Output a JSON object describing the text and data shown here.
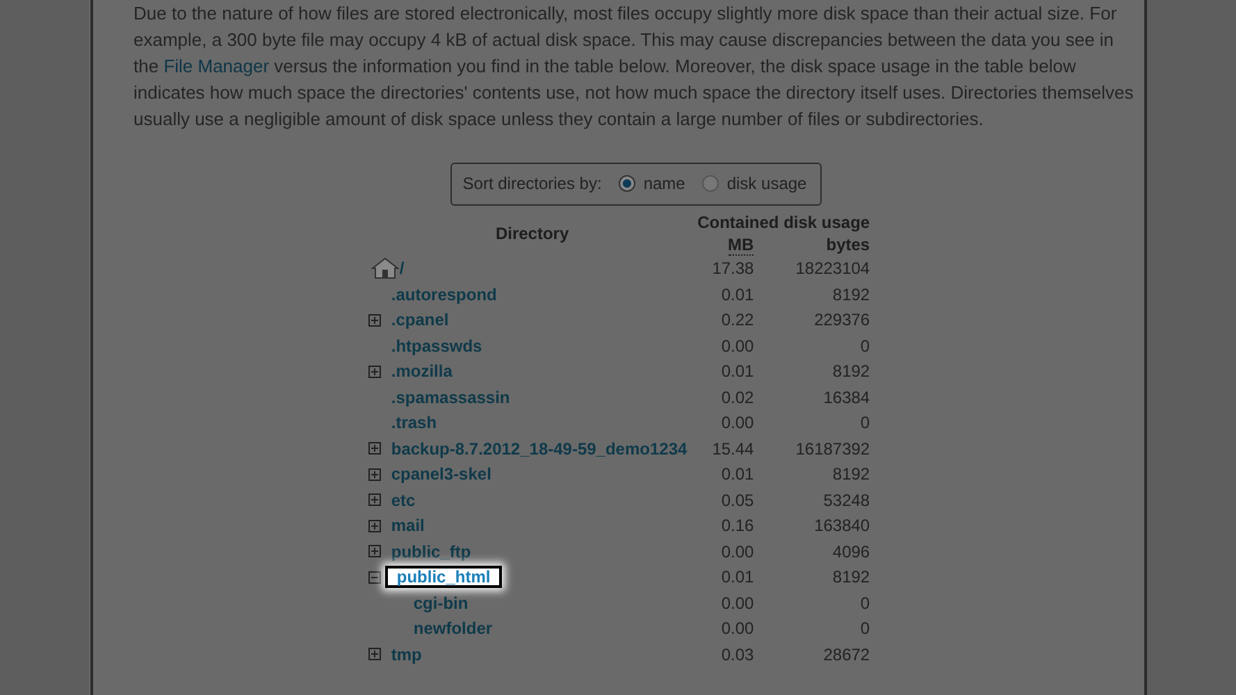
{
  "intro": {
    "lines": [
      "Due to the nature of how files are stored electronically, most files occupy slightly more disk space than their actual size. For",
      "example, a 300 byte file may occupy 4 kB of actual disk space. This may cause discrepancies between the data you see in the "
    ],
    "link": "File Manager",
    "rest": " versus the information you find in the table below. Moreover, the disk space usage in the table below indicates how much space the directories' contents use, not how much space the directory itself uses. Directories themselves usually use a negligible amount of disk space unless they contain a large number of files or subdirectories."
  },
  "sort": {
    "label": "Sort directories by:",
    "options": [
      {
        "label": "name",
        "selected": true
      },
      {
        "label": "disk usage",
        "selected": false
      }
    ]
  },
  "table": {
    "group_header": "Contained disk usage",
    "directory_header": "Directory",
    "mb_header": "MB",
    "bytes_header": "bytes",
    "rows": [
      {
        "kind": "home",
        "name": "/",
        "mb": "17.38",
        "bytes": "18223104",
        "highlighted": false
      },
      {
        "kind": "none",
        "name": ".autorespond",
        "mb": "0.01",
        "bytes": "8192",
        "highlighted": false
      },
      {
        "kind": "plus",
        "name": ".cpanel",
        "mb": "0.22",
        "bytes": "229376",
        "highlighted": false
      },
      {
        "kind": "none",
        "name": ".htpasswds",
        "mb": "0.00",
        "bytes": "0",
        "highlighted": false
      },
      {
        "kind": "plus",
        "name": ".mozilla",
        "mb": "0.01",
        "bytes": "8192",
        "highlighted": false
      },
      {
        "kind": "none",
        "name": ".spamassassin",
        "mb": "0.02",
        "bytes": "16384",
        "highlighted": false
      },
      {
        "kind": "none",
        "name": ".trash",
        "mb": "0.00",
        "bytes": "0",
        "highlighted": false
      },
      {
        "kind": "plus",
        "name": "backup-8.7.2012_18-49-59_demo1234",
        "mb": "15.44",
        "bytes": "16187392",
        "highlighted": false
      },
      {
        "kind": "plus",
        "name": "cpanel3-skel",
        "mb": "0.01",
        "bytes": "8192",
        "highlighted": false
      },
      {
        "kind": "plus",
        "name": "etc",
        "mb": "0.05",
        "bytes": "53248",
        "highlighted": false
      },
      {
        "kind": "plus",
        "name": "mail",
        "mb": "0.16",
        "bytes": "163840",
        "highlighted": false
      },
      {
        "kind": "plus",
        "name": "public_ftp",
        "mb": "0.00",
        "bytes": "4096",
        "highlighted": false
      },
      {
        "kind": "minus",
        "name": "public_html",
        "mb": "0.01",
        "bytes": "8192",
        "highlighted": true,
        "children": [
          {
            "kind": "none",
            "name": "cgi-bin",
            "mb": "0.00",
            "bytes": "0",
            "highlighted": false
          },
          {
            "kind": "none",
            "name": "newfolder",
            "mb": "0.00",
            "bytes": "0",
            "highlighted": false
          }
        ]
      },
      {
        "kind": "plus",
        "name": "tmp",
        "mb": "0.03",
        "bytes": "28672",
        "highlighted": false
      }
    ]
  }
}
